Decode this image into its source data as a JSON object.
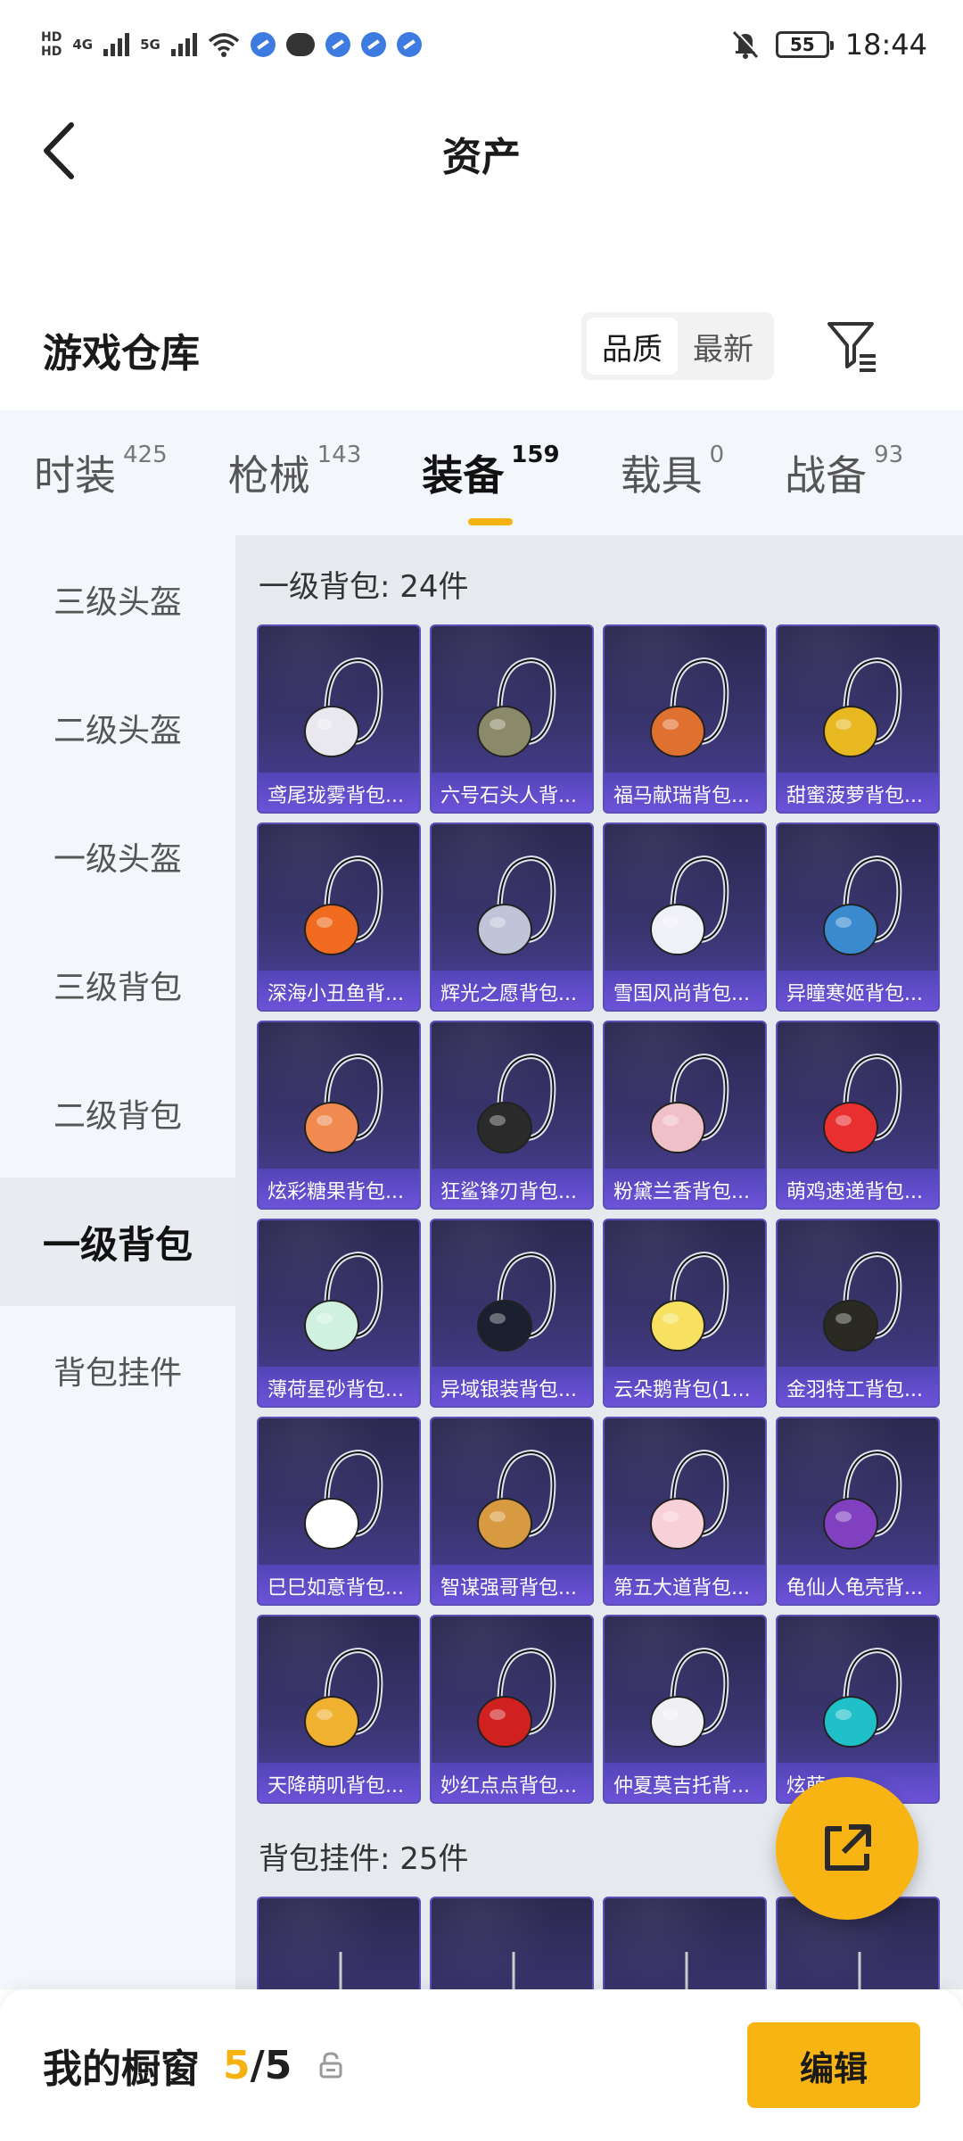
{
  "status_bar": {
    "network_1": "4G",
    "network_2": "5G",
    "battery": "55",
    "time": "18:44"
  },
  "header": {
    "title": "资产"
  },
  "warehouse": {
    "title": "游戏仓库",
    "sort_options": [
      "品质",
      "最新"
    ],
    "sort_selected": "品质"
  },
  "tabs": [
    {
      "label": "时装",
      "count": "425"
    },
    {
      "label": "枪械",
      "count": "143"
    },
    {
      "label": "装备",
      "count": "159"
    },
    {
      "label": "载具",
      "count": "0"
    },
    {
      "label": "战备",
      "count": "93"
    }
  ],
  "active_tab": "装备",
  "sidebar": {
    "items": [
      {
        "label": "三级头盔"
      },
      {
        "label": "二级头盔"
      },
      {
        "label": "一级头盔"
      },
      {
        "label": "三级背包"
      },
      {
        "label": "二级背包"
      },
      {
        "label": "一级背包"
      },
      {
        "label": "背包挂件"
      }
    ],
    "selected": "一级背包"
  },
  "groups": [
    {
      "title": "一级背包: 24件",
      "items": [
        "鸢尾珑雾背包...",
        "六号石头人背...",
        "福马献瑞背包...",
        "甜蜜菠萝背包...",
        "深海小丑鱼背...",
        "辉光之愿背包...",
        "雪国风尚背包...",
        "异瞳寒姬背包...",
        "炫彩糖果背包...",
        "狂鲨锋刃背包...",
        "粉黛兰香背包...",
        "萌鸡速递背包...",
        "薄荷星砂背包...",
        "异域银装背包...",
        "云朵鹅背包(1...",
        "金羽特工背包...",
        "巳巳如意背包...",
        "智谋强哥背包...",
        "第五大道背包...",
        "龟仙人龟壳背...",
        "天降萌叽背包...",
        "妙红点点背包...",
        "仲夏莫吉托背...",
        "炫萌..."
      ]
    },
    {
      "title": "背包挂件: 25件",
      "items": [
        "",
        "",
        "",
        ""
      ]
    }
  ],
  "item_colors": [
    "#e8e8ee",
    "#8a8a6a",
    "#e07030",
    "#e8b820",
    "#f06a20",
    "#c0c4d8",
    "#f0f0f8",
    "#3a8ad0",
    "#f08a50",
    "#2a2a2a",
    "#f0c0c8",
    "#e83030",
    "#d0f0e0",
    "#1a2030",
    "#f8e060",
    "#2a2a22",
    "#ffffff",
    "#d89a40",
    "#f8d0d8",
    "#8040c0",
    "#f0b030",
    "#d02020",
    "#f0f0f4",
    "#20c0c8"
  ],
  "bottom_bar": {
    "label": "我的橱窗",
    "current": "5",
    "separator": "/",
    "total": "5",
    "edit": "编辑"
  },
  "colors": {
    "accent": "#f5b210",
    "card_bg": "#3b3672",
    "card_label_bg": "#6e54dc"
  }
}
